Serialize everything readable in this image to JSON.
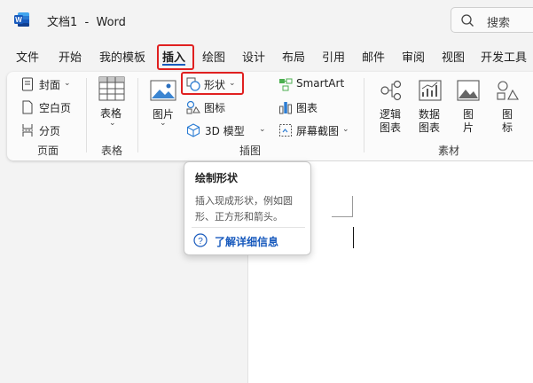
{
  "title_bar": {
    "doc_name": "文档1",
    "separator": "-",
    "app_name": "Word",
    "search_label": "搜索"
  },
  "menu_tabs": [
    {
      "label": "文件"
    },
    {
      "label": "开始"
    },
    {
      "label": "我的模板"
    },
    {
      "label": "插入",
      "active": true
    },
    {
      "label": "绘图"
    },
    {
      "label": "设计"
    },
    {
      "label": "布局"
    },
    {
      "label": "引用"
    },
    {
      "label": "邮件"
    },
    {
      "label": "审阅"
    },
    {
      "label": "视图"
    },
    {
      "label": "开发工具"
    }
  ],
  "ribbon": {
    "pages": {
      "cover": "封面",
      "blank": "空白页",
      "break": "分页",
      "label": "页面"
    },
    "tables": {
      "table_btn": "表格",
      "label": "表格"
    },
    "illustrations": {
      "pictures": "图片",
      "shapes": "形状",
      "icons": "图标",
      "models_3d": "3D 模型",
      "smartart": "SmartArt",
      "chart": "图表",
      "screenshot": "屏幕截图",
      "label": "插图"
    },
    "assets": {
      "logic_line1": "逻辑",
      "logic_line2": "图表",
      "data_line1": "数据",
      "data_line2": "图表",
      "pic_line1": "图",
      "pic_line2": "片",
      "icon_line1": "图",
      "icon_line2": "标",
      "label": "素材"
    }
  },
  "tooltip": {
    "title": "绘制形状",
    "description": "插入现成形状，例如圆形、正方形和箭头。",
    "link": "了解详细信息"
  },
  "colors": {
    "accent": "#185abd",
    "highlight": "#e02020",
    "word_brand": "#185abd"
  }
}
